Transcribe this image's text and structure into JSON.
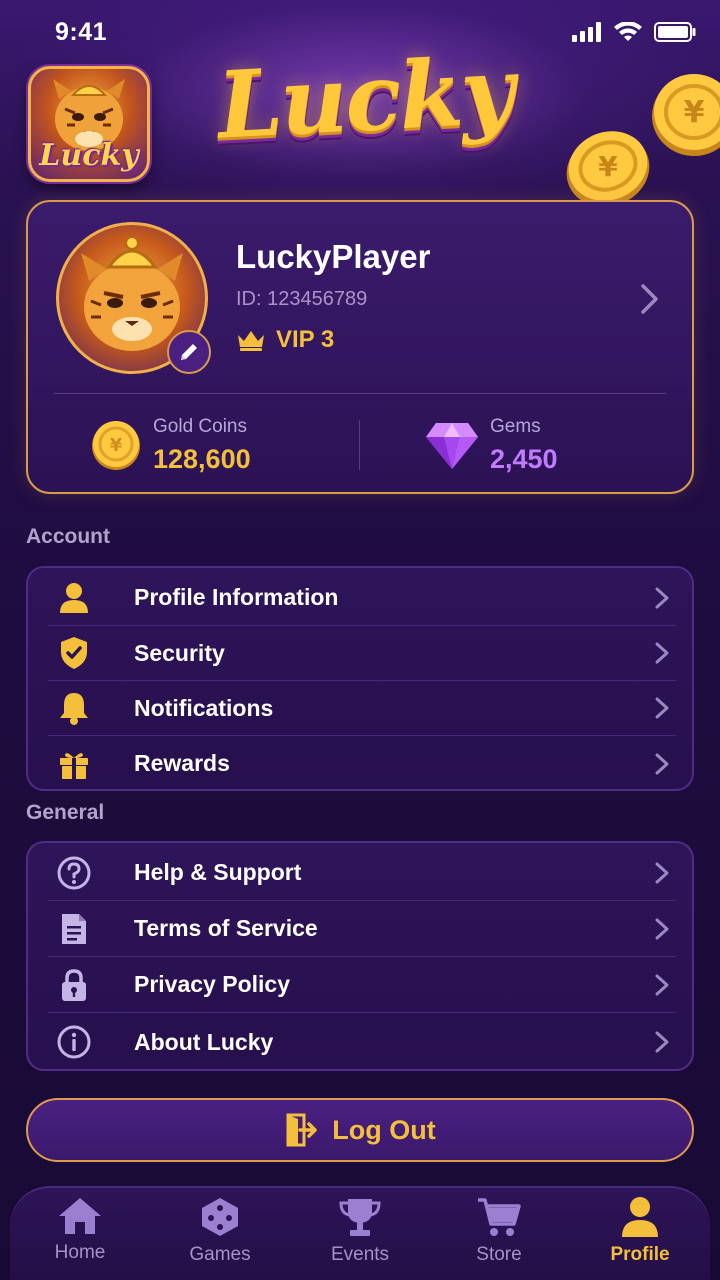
{
  "status_bar": {
    "time": "9:41"
  },
  "header": {
    "app_icon_text": "Lucky",
    "logo_text": "Lucky"
  },
  "profile": {
    "username": "LuckyPlayer",
    "id_text": "ID: 123456789",
    "vip_text": "VIP 3",
    "gold": {
      "label": "Gold Coins",
      "value": "128,600"
    },
    "gems": {
      "label": "Gems",
      "value": "2,450"
    }
  },
  "account": {
    "title": "Account",
    "items": [
      {
        "label": "Profile Information",
        "icon": "user-icon"
      },
      {
        "label": "Security",
        "icon": "shield-icon"
      },
      {
        "label": "Notifications",
        "icon": "bell-icon"
      },
      {
        "label": "Rewards",
        "icon": "gift-icon"
      }
    ]
  },
  "general": {
    "title": "General",
    "items": [
      {
        "label": "Help & Support",
        "icon": "question-circle-icon"
      },
      {
        "label": "Terms of Service",
        "icon": "document-icon"
      },
      {
        "label": "Privacy Policy",
        "icon": "lock-icon"
      },
      {
        "label": "About Lucky",
        "icon": "info-circle-icon"
      }
    ]
  },
  "logout_label": "Log Out",
  "nav": {
    "items": [
      {
        "label": "Home",
        "icon": "home-icon"
      },
      {
        "label": "Games",
        "icon": "dice-icon"
      },
      {
        "label": "Events",
        "icon": "trophy-icon"
      },
      {
        "label": "Store",
        "icon": "cart-icon"
      },
      {
        "label": "Profile",
        "icon": "user-icon"
      }
    ],
    "active": "Profile"
  },
  "colors": {
    "accent_gold": "#f4bf3a",
    "gem_purple": "#c27bff",
    "background": "#1f0c40",
    "card_border": "#d99a4a"
  }
}
